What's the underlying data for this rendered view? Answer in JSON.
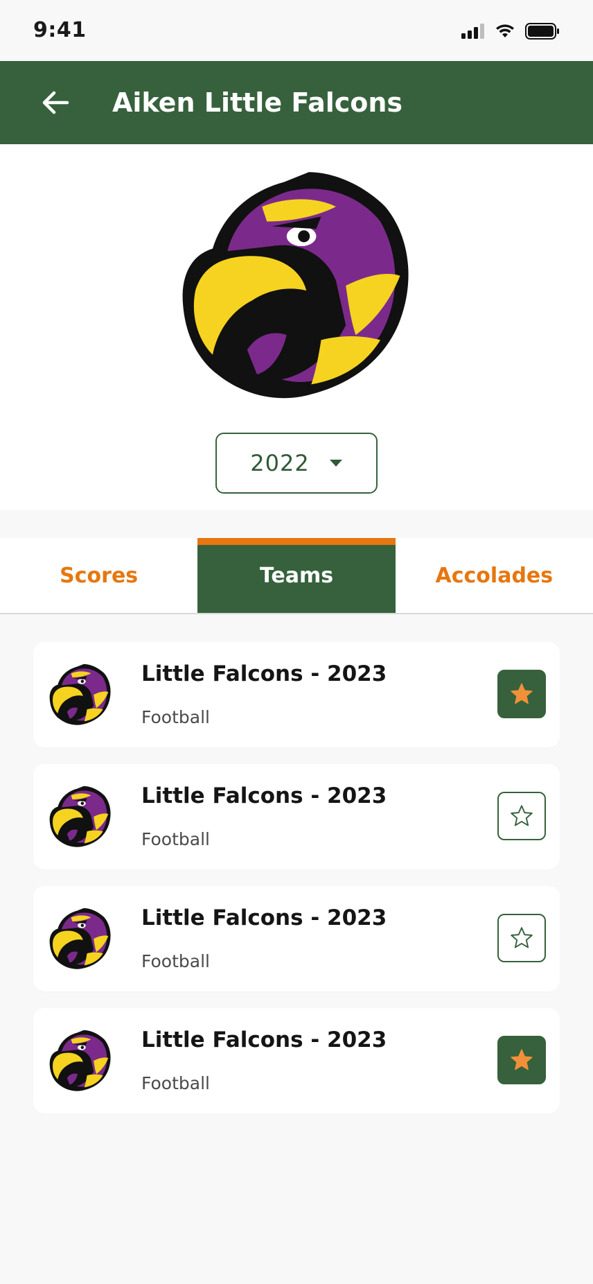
{
  "status": {
    "time": "9:41"
  },
  "header": {
    "title": "Aiken Little Falcons",
    "back_icon": "arrow-left-icon"
  },
  "year_select": {
    "value": "2022",
    "icon": "caret-down-icon"
  },
  "tabs": [
    {
      "label": "Scores",
      "active": false
    },
    {
      "label": "Teams",
      "active": true
    },
    {
      "label": "Accolades",
      "active": false
    }
  ],
  "teams": [
    {
      "name": "Little Falcons - 2023",
      "sport": "Football",
      "favorite": true
    },
    {
      "name": "Little Falcons - 2023",
      "sport": "Football",
      "favorite": false
    },
    {
      "name": "Little Falcons - 2023",
      "sport": "Football",
      "favorite": false
    },
    {
      "name": "Little Falcons - 2023",
      "sport": "Football",
      "favorite": true
    }
  ],
  "colors": {
    "primary": "#36613c",
    "accent": "#e67710",
    "falcon_purple": "#7b2a8c",
    "falcon_yellow": "#f5d320"
  }
}
